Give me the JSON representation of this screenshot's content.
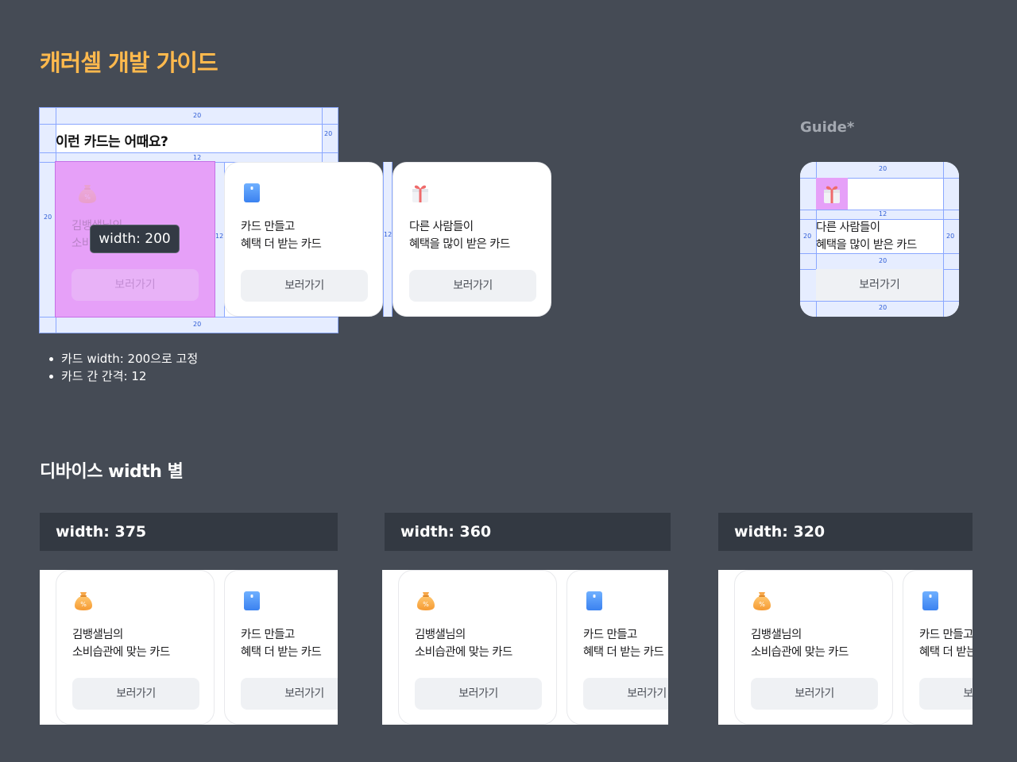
{
  "page_title": "캐러셀 개발 가이드",
  "spec": {
    "heading": "이런 카드는 어때요?",
    "dims": {
      "top": "20",
      "right": "20",
      "left": "20",
      "gap_heading": "12",
      "gap_cards": "12",
      "gap_cards_2": "12",
      "bottom": "20"
    },
    "tooltip": "width: 200"
  },
  "cards": [
    {
      "icon": "money-bag-icon",
      "line1": "김뱅샐님의",
      "line2": "소비습관에 맞는 카드",
      "button": "보러가기"
    },
    {
      "icon": "card-icon",
      "line1": "카드 만들고",
      "line2": "혜택 더 받는 카드",
      "button": "보러가기"
    },
    {
      "icon": "gift-icon",
      "line1": "다른 사람들이",
      "line2": "혜택을 많이 받은 카드",
      "button": "보러가기"
    }
  ],
  "notes": [
    "카드 width: 200으로 고정",
    "카드 간 간격: 12"
  ],
  "guide": {
    "label": "Guide*",
    "dims": {
      "top": "20",
      "gap": "12",
      "left": "20",
      "right": "20",
      "above_button": "20",
      "bottom": "20"
    },
    "line1": "다른 사람들이",
    "line2": "혜택을 많이 받은 카드",
    "button": "보러가기"
  },
  "section_title": "디바이스 width 별",
  "devices": [
    {
      "label": "width: 375"
    },
    {
      "label": "width: 360"
    },
    {
      "label": "width: 320"
    }
  ],
  "colors": {
    "background": "#454b55",
    "title": "#ffb94d",
    "highlight": "#e6a0f8",
    "guide_line": "#8aa7ff"
  }
}
